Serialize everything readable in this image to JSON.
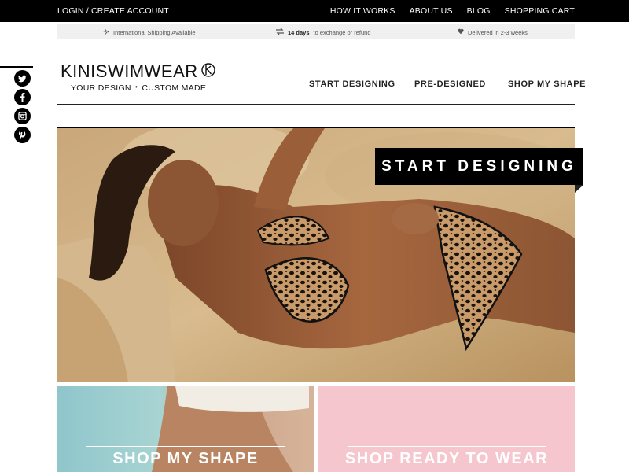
{
  "topbar": {
    "login_label": "LOGIN / CREATE ACCOUNT",
    "nav": [
      "HOW IT WORKS",
      "ABOUT US",
      "BLOG",
      "SHOPPING CART"
    ]
  },
  "infobar": {
    "shipping": "International Shipping Available",
    "exchange_bold": "14 days",
    "exchange_rest": "to exchange or refund",
    "delivery": "Delivered in 2-3 weeks"
  },
  "social": [
    "twitter-icon",
    "facebook-icon",
    "instagram-icon",
    "pinterest-icon"
  ],
  "logo": {
    "brand": "KINISWIMWEAR",
    "tagline_a": "YOUR DESIGN",
    "tagline_sep": "•",
    "tagline_b": "CUSTOM MADE"
  },
  "mainnav": [
    "START DESIGNING",
    "PRE-DESIGNED",
    "SHOP MY SHAPE"
  ],
  "hero": {
    "cta_label": "START DESIGNING"
  },
  "tiles": {
    "left_label": "SHOP MY SHAPE",
    "right_label": "SHOP READY TO WEAR"
  },
  "colors": {
    "topbar_bg": "#000000",
    "infobar_bg": "#f0f0f0",
    "tile_right_bg": "#f5c6cd",
    "tile_left_bg": "#a8d4d2"
  }
}
